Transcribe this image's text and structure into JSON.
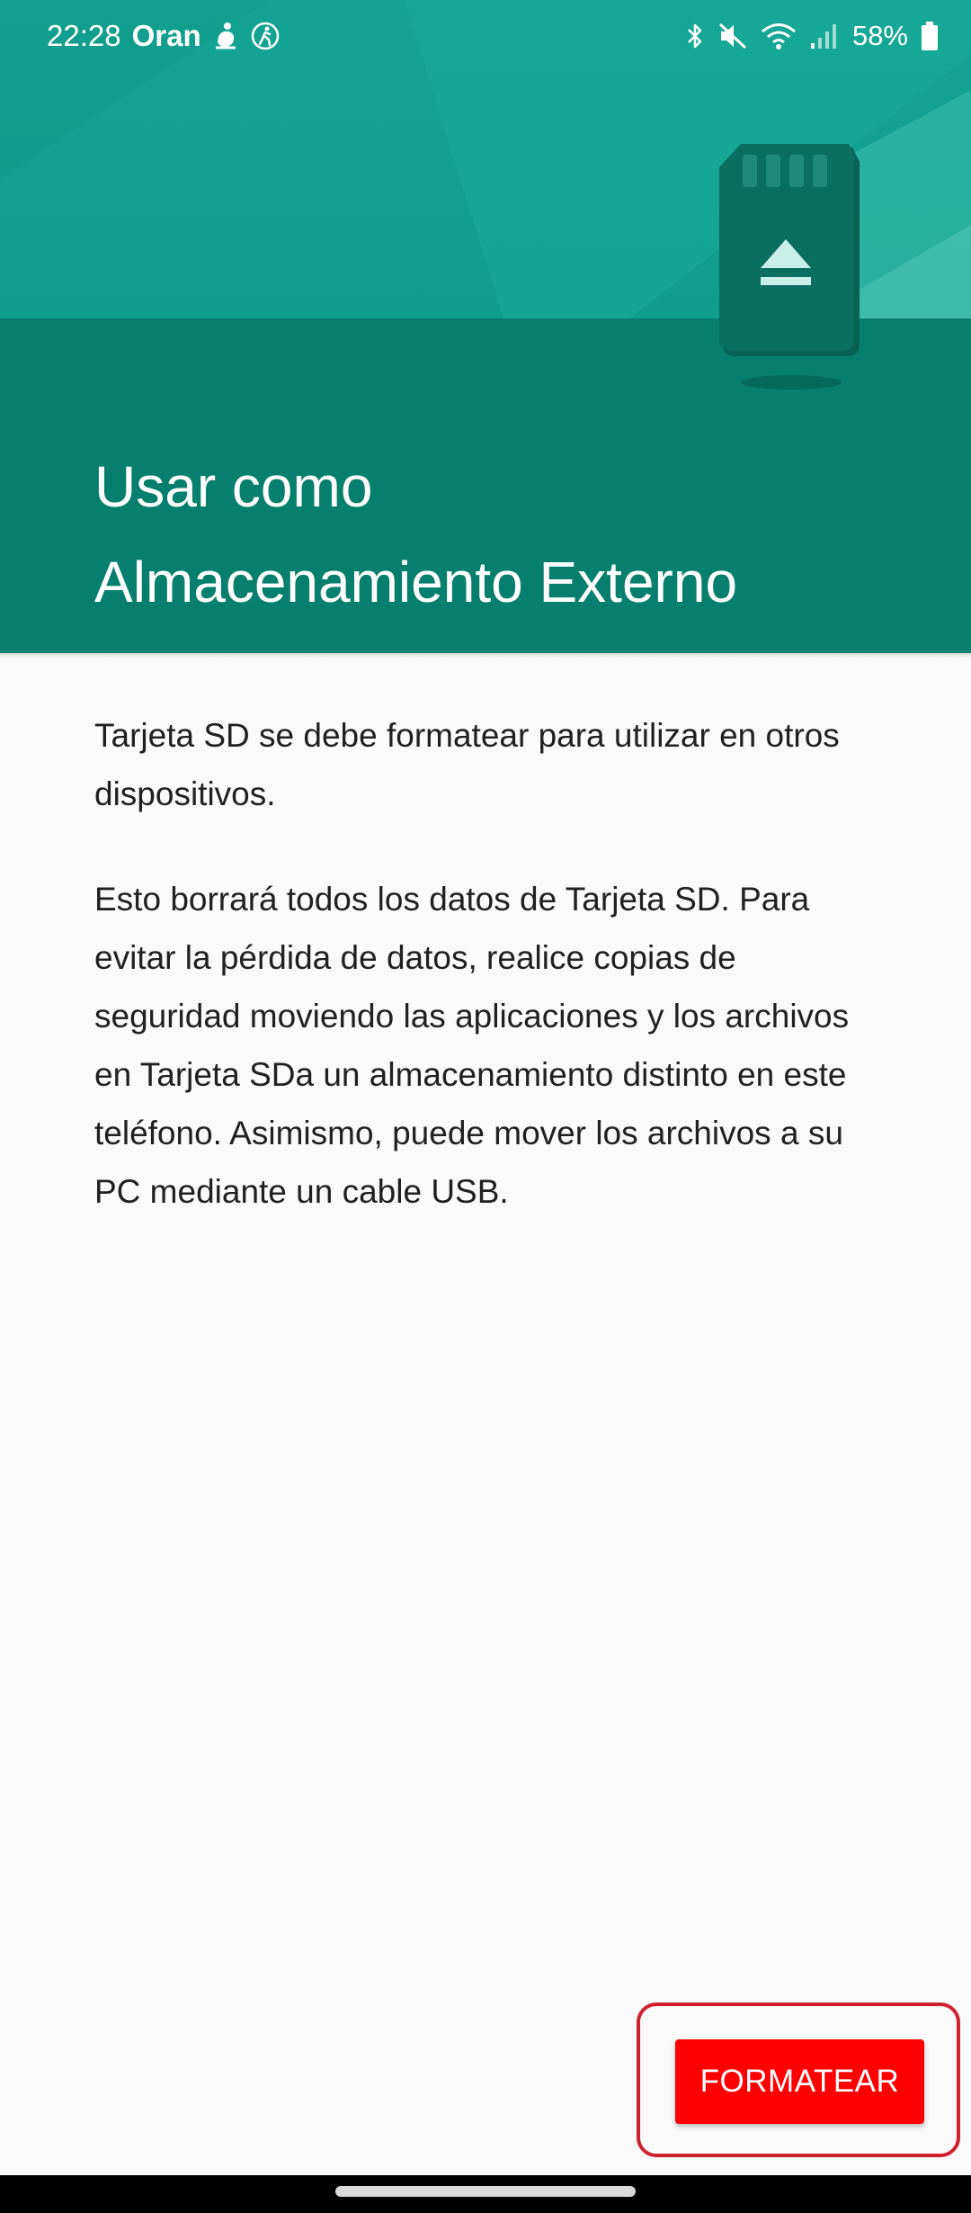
{
  "status_bar": {
    "time": "22:28",
    "carrier": "Oran",
    "battery_percent": "58%",
    "left_icons": [
      "hand-wave-icon",
      "walking-person-icon"
    ],
    "right_icons": [
      "bluetooth-icon",
      "muted-icon",
      "wifi-icon",
      "signal-icon",
      "battery-icon"
    ]
  },
  "header": {
    "title_line1": "Usar como",
    "title_line2": "Almacenamiento Externo",
    "illustration_icon": "sd-card-eject-icon",
    "colors": {
      "header_dark": "#077f6e",
      "header_light": "#14a394"
    }
  },
  "body": {
    "paragraph1": "Tarjeta SD se debe formatear para utilizar en otros dispositivos.",
    "paragraph2": "Esto borrará todos los datos de Tarjeta SD. Para evitar la pérdida de datos, realice copias de seguridad moviendo las aplicaciones y los archivos en Tarjeta SDa un almacenamiento distinto en este teléfono. Asimismo, puede mover los archivos a su PC mediante un cable USB."
  },
  "footer": {
    "format_button_label": "FORMATEAR",
    "button_color": "#ff0000",
    "highlight_color": "#d0202e"
  }
}
